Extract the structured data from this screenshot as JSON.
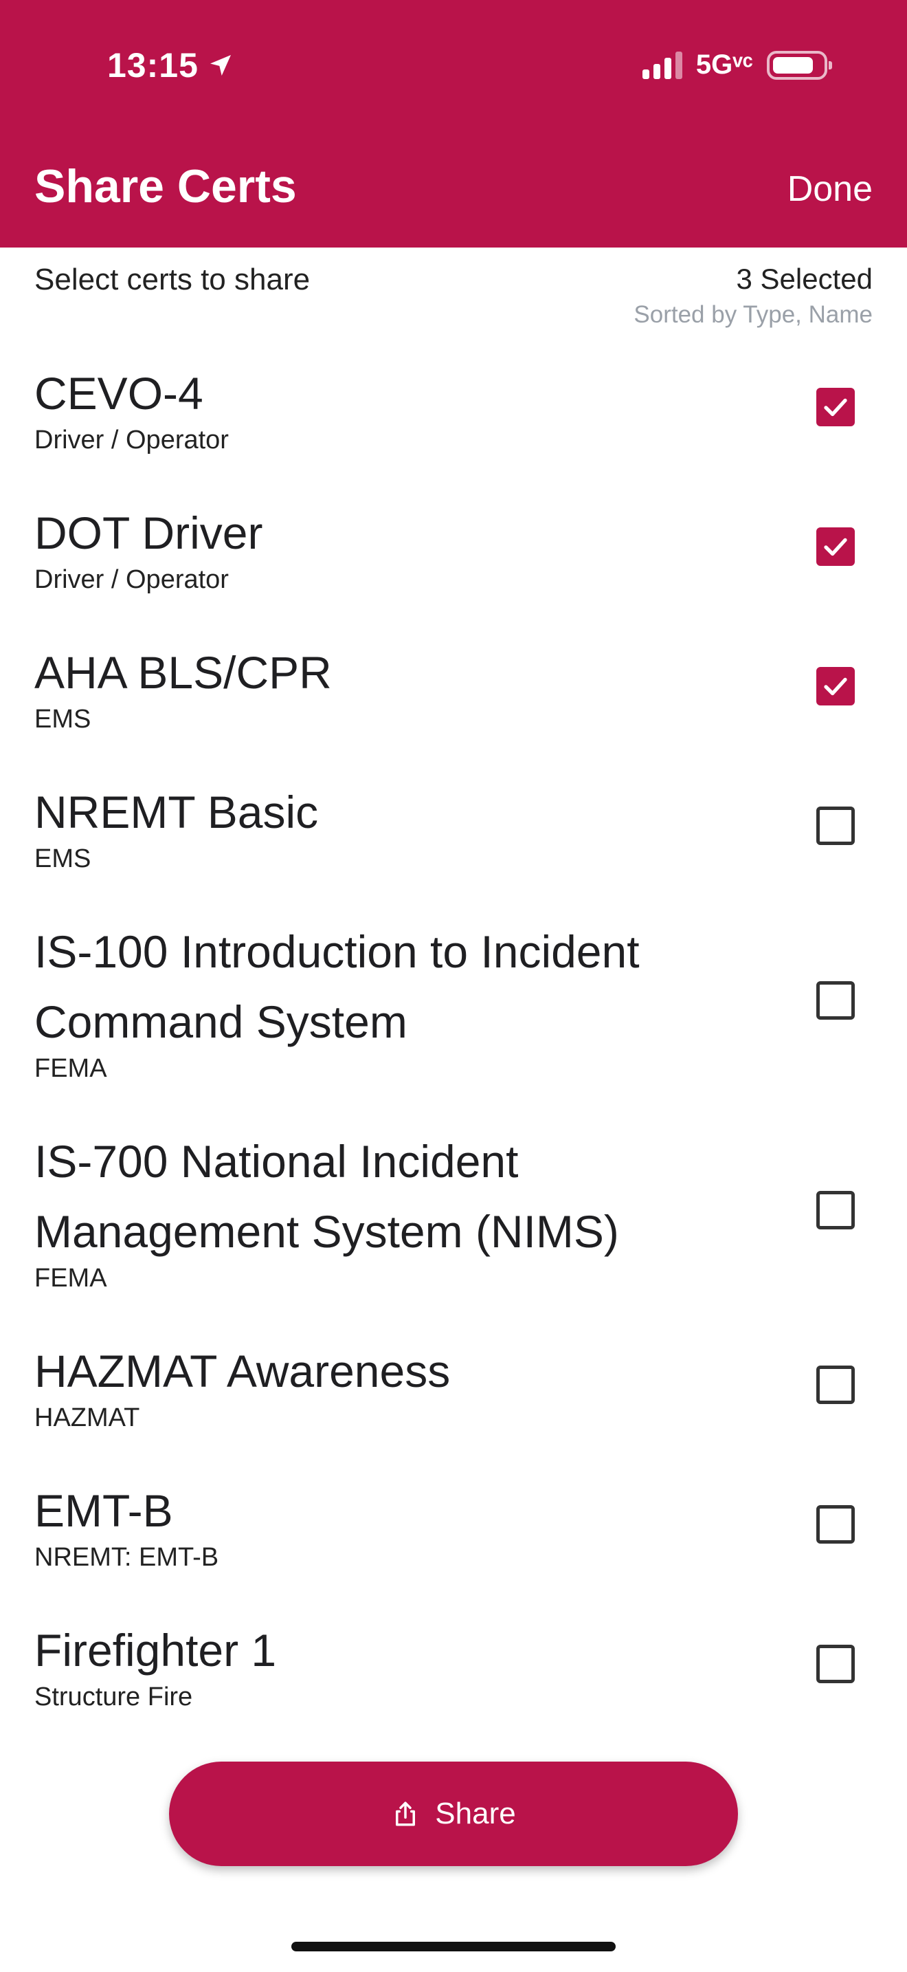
{
  "status_bar": {
    "time": "13:15",
    "network": "5Gᵛᶜ"
  },
  "header": {
    "title": "Share Certs",
    "done_label": "Done"
  },
  "toolbar": {
    "select_label": "Select certs to share",
    "selected_count": "3 Selected",
    "sorted_by": "Sorted by Type, Name"
  },
  "certs": [
    {
      "name": "CEVO-4",
      "type": "Driver / Operator",
      "checked": true
    },
    {
      "name": "DOT Driver",
      "type": "Driver / Operator",
      "checked": true
    },
    {
      "name": "AHA BLS/CPR",
      "type": "EMS",
      "checked": true
    },
    {
      "name": "NREMT Basic",
      "type": "EMS",
      "checked": false
    },
    {
      "name": "IS-100 Introduction to Incident Command System",
      "type": "FEMA",
      "checked": false
    },
    {
      "name": "IS-700 National Incident Management System (NIMS)",
      "type": "FEMA",
      "checked": false
    },
    {
      "name": "HAZMAT Awareness",
      "type": "HAZMAT",
      "checked": false
    },
    {
      "name": "EMT-B",
      "type": "NREMT: EMT-B",
      "checked": false
    },
    {
      "name": "Firefighter 1",
      "type": "Structure Fire",
      "checked": false
    }
  ],
  "share_button": {
    "label": "Share"
  },
  "colors": {
    "accent": "#b9134a"
  }
}
